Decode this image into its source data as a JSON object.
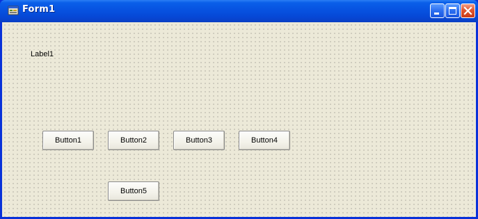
{
  "window": {
    "title": "Form1",
    "icon": "form-icon",
    "controls": {
      "minimize_icon": "minimize-icon",
      "maximize_icon": "maximize-icon",
      "close_icon": "close-icon"
    }
  },
  "form": {
    "label": "Label1",
    "buttons": [
      "Button1",
      "Button2",
      "Button3",
      "Button4",
      "Button5"
    ]
  },
  "colors": {
    "titlebar": "#0752e0",
    "client_background": "#ece9d8",
    "close_button": "#e0562f"
  }
}
